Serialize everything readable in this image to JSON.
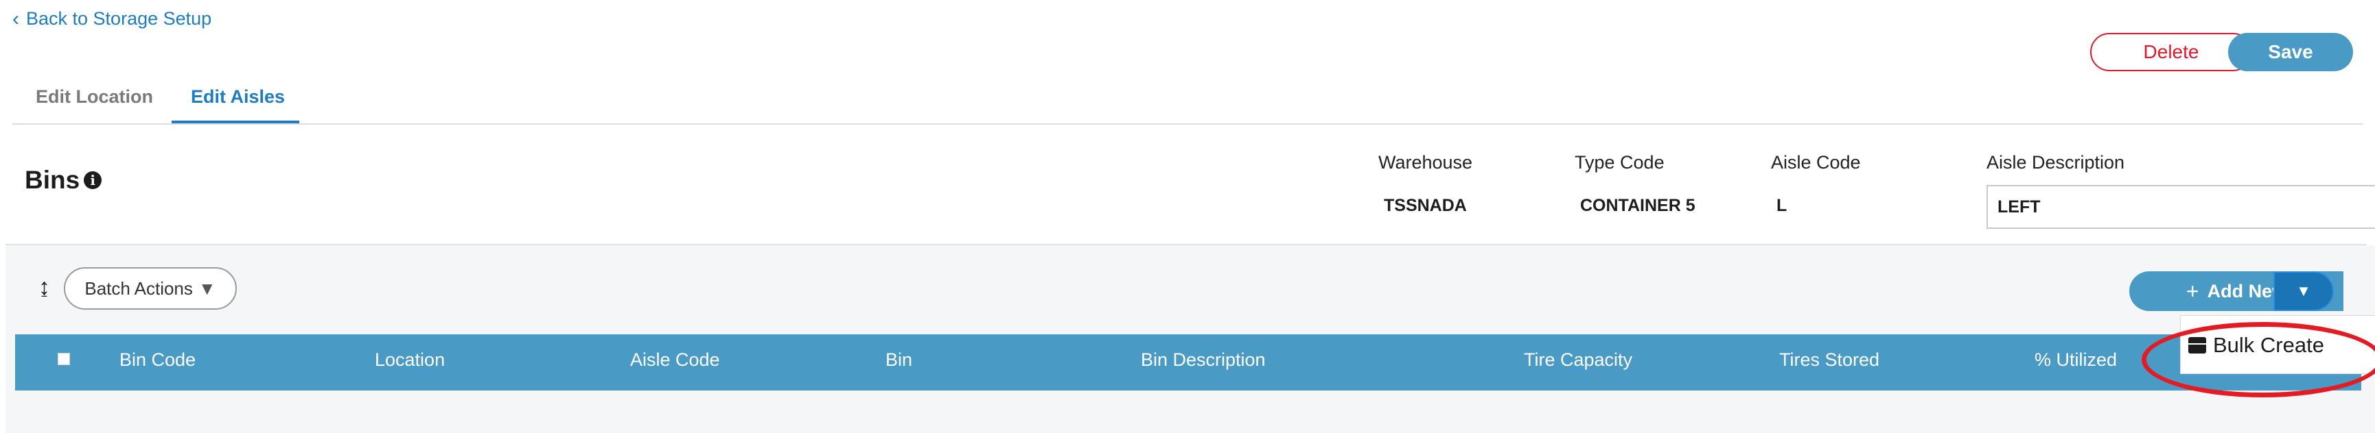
{
  "nav": {
    "back_label": "Back to Storage Setup"
  },
  "actions": {
    "delete_label": "Delete",
    "save_label": "Save"
  },
  "tabs": [
    {
      "label": "Edit Location",
      "active": false
    },
    {
      "label": "Edit Aisles",
      "active": true
    }
  ],
  "header": {
    "title": "Bins",
    "info_icon": "i",
    "fields": {
      "warehouse_label": "Warehouse",
      "warehouse_value": "TSSNADA",
      "type_code_label": "Type Code",
      "type_code_value": "CONTAINER 5",
      "aisle_code_label": "Aisle Code",
      "aisle_code_value": "L",
      "aisle_description_label": "Aisle Description",
      "aisle_description_value": "LEFT"
    }
  },
  "toolbar": {
    "sort_icon": "↨",
    "batch_actions_label": "Batch Actions",
    "batch_caret": "▼",
    "add_new_label": "Add New",
    "add_new_icon": "+",
    "add_new_caret": "▼"
  },
  "table": {
    "columns": [
      "Bin Code",
      "Location",
      "Aisle Code",
      "Bin",
      "Bin Description",
      "Tire Capacity",
      "Tires Stored",
      "% Utilized"
    ]
  },
  "dropdown": {
    "items": [
      {
        "label": "Bulk Create",
        "icon": "box-icon"
      }
    ]
  },
  "colors": {
    "accent": "#1f7dbf",
    "header_blue": "#4a9ac6",
    "danger": "#e0182d",
    "highlight": "#e41b23"
  }
}
